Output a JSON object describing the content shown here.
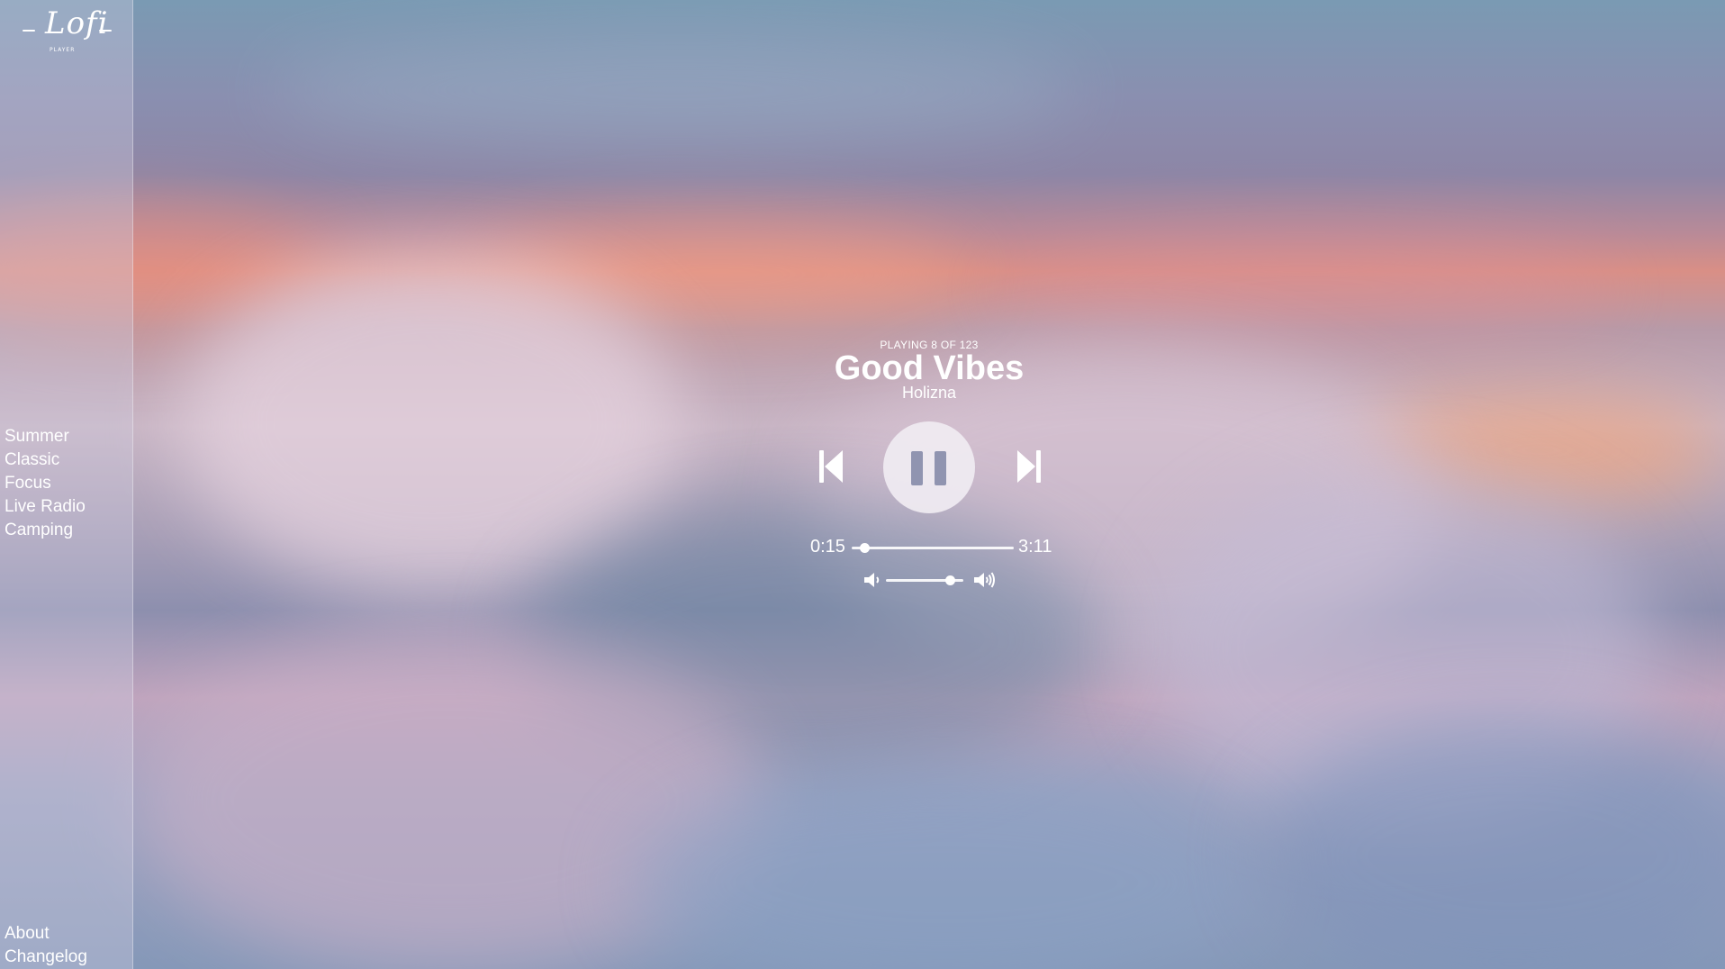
{
  "app": {
    "logo_text": "Lofi",
    "logo_subtext": "PLAYER"
  },
  "sidebar": {
    "items": [
      {
        "label": "Summer"
      },
      {
        "label": "Classic"
      },
      {
        "label": "Focus"
      },
      {
        "label": "Live Radio"
      },
      {
        "label": "Camping"
      }
    ],
    "bottom_items": [
      {
        "label": "About"
      },
      {
        "label": "Changelog"
      }
    ]
  },
  "player": {
    "status": "PLAYING 8 OF 123",
    "title": "Good Vibes",
    "artist": "Holizna",
    "current_time": "0:15",
    "total_time": "3:11",
    "progress_fraction": 0.08,
    "volume_fraction": 0.83,
    "state": "playing"
  },
  "icons": {
    "previous": "skip-back-icon",
    "pause": "pause-icon",
    "next": "skip-forward-icon",
    "volume_low": "volume-low-icon",
    "volume_high": "volume-high-icon"
  },
  "colors": {
    "text": "#ffffff",
    "play_button_bg": "#f0ecf2",
    "pause_icon": "#9094b0"
  }
}
